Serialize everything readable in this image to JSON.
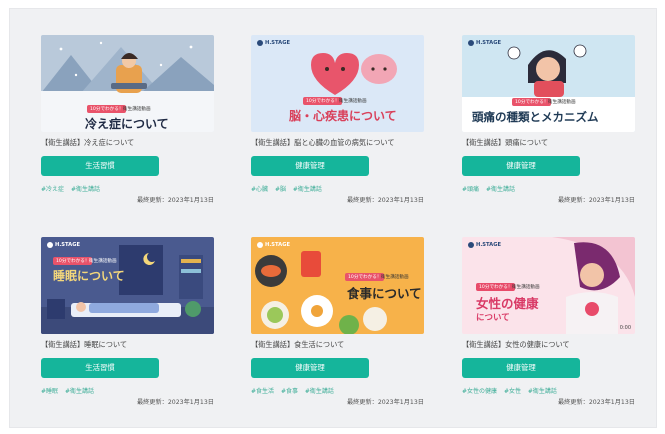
{
  "cards": [
    {
      "logo": "",
      "badge": "10分でわかる！",
      "badge_sub": "衛生講話動画",
      "banner_title": "冷え症について",
      "title": "【衛生講話】冷え症について",
      "button": "生活習慣",
      "tags": [
        "#冷え症",
        "#衛生講話"
      ],
      "updated": "最終更新：2023年1月13日"
    },
    {
      "logo": "H.STAGE",
      "badge": "10分でわかる！",
      "badge_sub": "衛生講話動画",
      "banner_title": "脳・心疾患について",
      "title": "【衛生講話】脳と心臓の血管の病気について",
      "button": "健康管理",
      "tags": [
        "#心臓",
        "#脳",
        "#衛生講話"
      ],
      "updated": "最終更新：2023年1月13日"
    },
    {
      "logo": "H.STAGE",
      "badge": "10分でわかる！",
      "badge_sub": "衛生講話動画",
      "banner_title": "頭痛の種類とメカニズム",
      "title": "【衛生講話】頭痛について",
      "button": "健康管理",
      "tags": [
        "#頭痛",
        "#衛生講話"
      ],
      "updated": "最終更新：2023年1月13日"
    },
    {
      "logo": "H.STAGE",
      "badge": "10分でわかる！",
      "badge_sub": "衛生講話動画",
      "banner_title": "睡眠について",
      "title": "【衛生講話】睡眠について",
      "button": "生活習慣",
      "tags": [
        "#睡眠",
        "#衛生講話"
      ],
      "updated": "最終更新：2023年1月13日"
    },
    {
      "logo": "H.STAGE",
      "badge": "10分でわかる！",
      "badge_sub": "衛生講話動画",
      "banner_title": "食事について",
      "title": "【衛生講話】食生活について",
      "button": "健康管理",
      "tags": [
        "#食生活",
        "#食事",
        "#衛生講話"
      ],
      "updated": "最終更新：2023年1月13日"
    },
    {
      "logo": "H.STAGE",
      "badge": "10分でわかる！",
      "badge_sub": "衛生講話動画",
      "banner_title": "女性の健康",
      "banner_title2": "について",
      "corner": "0:00",
      "title": "【衛生講話】女性の健康について",
      "button": "健康管理",
      "tags": [
        "#女性の健康",
        "#女性",
        "#衛生講話"
      ],
      "updated": "最終更新：2023年1月13日"
    }
  ]
}
